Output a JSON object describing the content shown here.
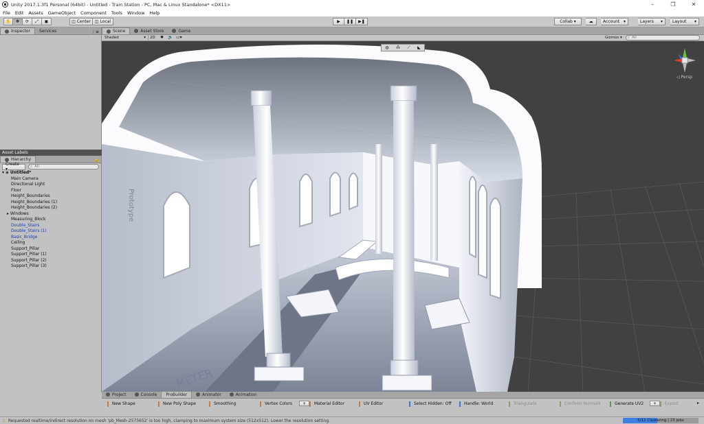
{
  "window": {
    "title": "Unity 2017.1.3f1 Personal (64bit) - Untitled - Train Station - PC, Mac & Linux Standalone* <DX11>",
    "controls": [
      "–",
      "❐",
      "✕"
    ]
  },
  "menu": [
    "File",
    "Edit",
    "Assets",
    "GameObject",
    "Component",
    "Tools",
    "Window",
    "Help"
  ],
  "toolbar": {
    "pivot_label": "Center",
    "space_label": "Local",
    "collab_label": "Collab ▾",
    "account_label": "Account",
    "layers_label": "Layers",
    "layout_label": "Layout"
  },
  "inspector_tabs": [
    "Inspector",
    "Services"
  ],
  "asset_labels": "Asset Labels",
  "hierarchy": {
    "tab": "Hierarchy",
    "create_label": "Create ▾",
    "search_placeholder": "All",
    "root": "Untitled*",
    "items": [
      {
        "label": "Main Camera",
        "prefab": false,
        "foldout": false
      },
      {
        "label": "Directional Light",
        "prefab": false,
        "foldout": false
      },
      {
        "label": "Floor",
        "prefab": false,
        "foldout": false
      },
      {
        "label": "Height_Boundaries",
        "prefab": false,
        "foldout": false
      },
      {
        "label": "Height_Boundaries (1)",
        "prefab": false,
        "foldout": false
      },
      {
        "label": "Height_Boundaries (2)",
        "prefab": false,
        "foldout": false
      },
      {
        "label": "Windows",
        "prefab": false,
        "foldout": true
      },
      {
        "label": "Measuring_Block",
        "prefab": false,
        "foldout": false
      },
      {
        "label": "Double_Stairs",
        "prefab": true,
        "foldout": false
      },
      {
        "label": "Double_Stairs (1)",
        "prefab": true,
        "foldout": false
      },
      {
        "label": "Basic_Bridge",
        "prefab": true,
        "foldout": false
      },
      {
        "label": "Ceiling",
        "prefab": false,
        "foldout": false
      },
      {
        "label": "Support_Pillar",
        "prefab": false,
        "foldout": false
      },
      {
        "label": "Support_Pillar (1)",
        "prefab": false,
        "foldout": false
      },
      {
        "label": "Support_Pillar (2)",
        "prefab": false,
        "foldout": false
      },
      {
        "label": "Support_Pillar (3)",
        "prefab": false,
        "foldout": false
      }
    ]
  },
  "scene_tabs": [
    "Scene",
    "Asset Store",
    "Game"
  ],
  "scene_toolbar": {
    "shading": "Shaded",
    "mode_2d": "2D",
    "gizmos": "Gizmos ▾",
    "search_placeholder": "All"
  },
  "viewport": {
    "persp_label": "Persp",
    "floor_text": "METER",
    "wall_text": "Prototype"
  },
  "bottom_tabs": [
    "Project",
    "Console",
    "ProBuilder",
    "Animator",
    "Animation"
  ],
  "probuilder": [
    {
      "label": "New Shape",
      "state": "orange"
    },
    {
      "label": "New Poly Shape",
      "state": "orange"
    },
    {
      "label": "Smoothing",
      "state": "orange"
    },
    {
      "label": "Vertex Colors",
      "state": "orange"
    },
    {
      "label": "Material Editor",
      "state": "orange"
    },
    {
      "label": "UV Editor",
      "state": "orange"
    },
    {
      "label": "Select Hidden: Off",
      "state": "blue"
    },
    {
      "label": "Handle: World",
      "state": "blue"
    },
    {
      "label": "Triangulate",
      "state": "grey"
    },
    {
      "label": "Conform Normals",
      "state": "grey"
    },
    {
      "label": "Generate UV2",
      "state": "green"
    },
    {
      "label": "Export",
      "state": "grey"
    }
  ],
  "status": {
    "message": "Requested realtime/indirect resolution on mesh 'pb_Mesh-2575652' is too high, clamping to maximum system size (512x512). Lower the resolution setting.",
    "progress_label": "5/11 Clustering | 23 jobs",
    "progress_fraction": 0.45
  }
}
